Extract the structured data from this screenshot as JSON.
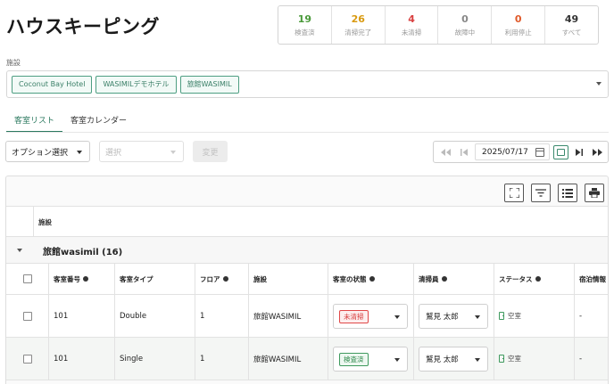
{
  "page": {
    "title": "ハウスキーピング"
  },
  "stats": [
    {
      "value": "19",
      "label": "検査済",
      "color": "#4a9a3a"
    },
    {
      "value": "26",
      "label": "清掃完了",
      "color": "#d99a10"
    },
    {
      "value": "4",
      "label": "未清掃",
      "color": "#d94040"
    },
    {
      "value": "0",
      "label": "故障中",
      "color": "#888888"
    },
    {
      "value": "0",
      "label": "利用停止",
      "color": "#e05a2a"
    },
    {
      "value": "49",
      "label": "すべて",
      "color": "#333333"
    }
  ],
  "facility": {
    "label": "施設",
    "chips": [
      "Coconut Bay Hotel",
      "WASIMILデモホテル",
      "旅館WASIMIL"
    ]
  },
  "tabs": {
    "list": "客室リスト",
    "calendar": "客室カレンダー"
  },
  "controls": {
    "option_select": "オプション選択",
    "choice_placeholder": "選択",
    "change_button": "変更",
    "date": "2025/07/17"
  },
  "table": {
    "facility_header": "施設",
    "group_name": "旅館wasimil (16)",
    "columns": {
      "room_number": "客室番号",
      "room_type": "客室タイプ",
      "floor": "フロア",
      "facility": "施設",
      "room_state": "客室の状態",
      "cleaner": "清掃員",
      "status": "ステータス",
      "stay_info": "宿泊情報"
    },
    "rows": [
      {
        "room_number": "101",
        "room_type": "Double",
        "floor": "1",
        "facility": "旅館WASIMIL",
        "state": "未清掃",
        "state_color": "red",
        "cleaner": "鷲見 太郎",
        "status": "空室",
        "stay": "-"
      },
      {
        "room_number": "101",
        "room_type": "Single",
        "floor": "1",
        "facility": "旅館WASIMIL",
        "state": "検査済",
        "state_color": "green",
        "cleaner": "鷲見 太郎",
        "status": "空室",
        "stay": "-"
      }
    ]
  }
}
